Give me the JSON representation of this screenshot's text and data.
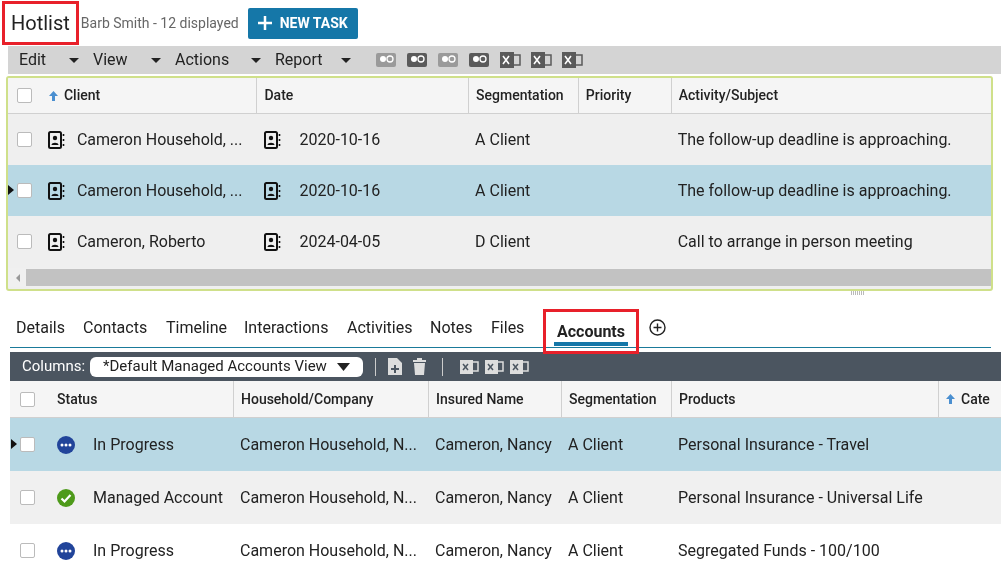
{
  "header": {
    "title": "Hotlist",
    "title_highlighted": true,
    "subtitle": "Barb Smith - 12 displayed",
    "new_task_button": "NEW TASK"
  },
  "menus": [
    "Edit",
    "View",
    "Actions",
    "Report"
  ],
  "hotlist_grid": {
    "select_all_checked": false,
    "columns": [
      {
        "label": "Client",
        "sorted": true
      },
      {
        "label": "Date",
        "sorted": false
      },
      {
        "label": "Segmentation",
        "sorted": false
      },
      {
        "label": "Priority",
        "sorted": false
      },
      {
        "label": "Activity/Subject",
        "sorted": false
      }
    ],
    "rows": [
      {
        "selected": false,
        "checked": false,
        "client": "Cameron Household, ...",
        "date": "2020-10-16",
        "segmentation": "A Client",
        "priority": "",
        "activity": "The follow-up deadline is approaching."
      },
      {
        "selected": true,
        "checked": false,
        "client": "Cameron Household, ...",
        "date": "2020-10-16",
        "segmentation": "A Client",
        "priority": "",
        "activity": "The follow-up deadline is approaching."
      },
      {
        "selected": false,
        "checked": false,
        "client": "Cameron, Roberto",
        "date": "2024-04-05",
        "segmentation": "D Client",
        "priority": "",
        "activity": "Call to arrange in person meeting"
      }
    ]
  },
  "tabs": [
    {
      "label": "Details",
      "selected": false
    },
    {
      "label": "Contacts",
      "selected": false
    },
    {
      "label": "Timeline",
      "selected": false
    },
    {
      "label": "Interactions",
      "selected": false
    },
    {
      "label": "Activities",
      "selected": false
    },
    {
      "label": "Notes",
      "selected": false
    },
    {
      "label": "Files",
      "selected": false
    },
    {
      "label": "Accounts",
      "selected": true
    }
  ],
  "accounts_grid": {
    "columns_label": "Columns:",
    "view": "*Default Managed Accounts View",
    "select_all_checked": false,
    "columns": [
      {
        "label": "Status",
        "sorted": false
      },
      {
        "label": "Household/Company",
        "sorted": false
      },
      {
        "label": "Insured Name",
        "sorted": false
      },
      {
        "label": "Segmentation",
        "sorted": false
      },
      {
        "label": "Products",
        "sorted": false
      },
      {
        "label": "Cate",
        "sorted": true
      }
    ],
    "rows": [
      {
        "selected": true,
        "checked": false,
        "kind": "in_progress",
        "status": "In Progress",
        "household": "Cameron Household, N...",
        "insured": "Cameron, Nancy",
        "segmentation": "A Client",
        "products": "Personal Insurance - Travel"
      },
      {
        "selected": false,
        "checked": false,
        "kind": "managed",
        "status": "Managed Account",
        "household": "Cameron Household, N...",
        "insured": "Cameron, Nancy",
        "segmentation": "A Client",
        "products": "Personal Insurance - Universal Life"
      },
      {
        "selected": false,
        "checked": false,
        "kind": "in_progress",
        "status": "In Progress",
        "household": "Cameron Household, N...",
        "insured": "Cameron, Nancy",
        "segmentation": "A Client",
        "products": "Segregated Funds - 100/100"
      }
    ]
  }
}
